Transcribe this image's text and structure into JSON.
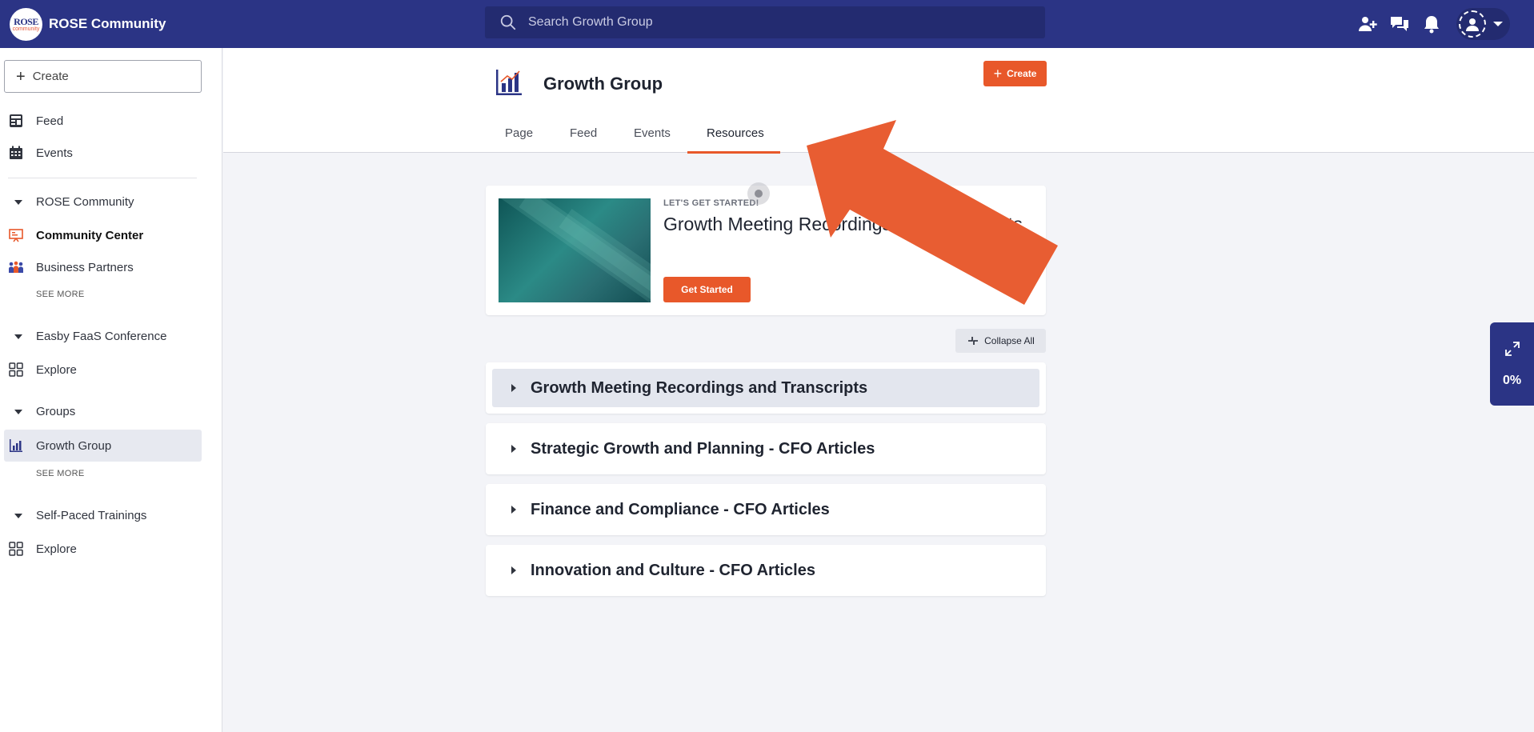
{
  "topbar": {
    "brand_logo_line1": "ROSE",
    "brand_logo_line2": "community",
    "brand_name": "ROSE Community",
    "search_placeholder": "Search Growth Group"
  },
  "sidebar": {
    "create_label": "Create",
    "feed_label": "Feed",
    "events_label": "Events",
    "sections": [
      {
        "label": "ROSE Community"
      },
      {
        "label": "Easby FaaS Conference"
      },
      {
        "label": "Groups"
      },
      {
        "label": "Self-Paced Trainings"
      }
    ],
    "rose_items": [
      "Community Center",
      "Business Partners"
    ],
    "see_more": "SEE MORE",
    "explore_label": "Explore",
    "group_item": "Growth Group"
  },
  "header": {
    "title": "Growth Group",
    "create_label": "Create",
    "tabs": [
      "Page",
      "Feed",
      "Events",
      "Resources"
    ],
    "active_tab": "Resources"
  },
  "hero": {
    "eyebrow": "LET'S GET STARTED!",
    "title": "Growth Meeting Recordings and Transcripts",
    "button": "Get Started"
  },
  "collapse_label": "Collapse All",
  "accordions": [
    "Growth Meeting Recordings and Transcripts",
    "Strategic Growth and Planning - CFO Articles",
    "Finance and Compliance - CFO Articles",
    "Innovation and Culture - CFO Articles"
  ],
  "progress": {
    "percent": "0%"
  },
  "colors": {
    "brand": "#2b3485",
    "accent": "#e8582a",
    "background": "#f3f4f8"
  }
}
